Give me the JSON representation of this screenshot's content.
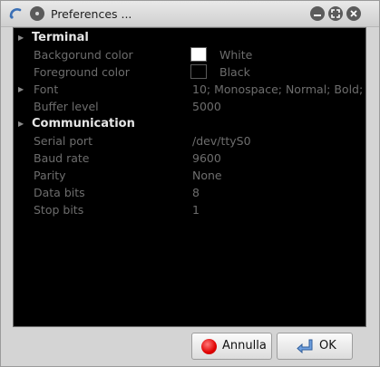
{
  "window": {
    "title": "Preferences ..."
  },
  "rows": [
    {
      "type": "group",
      "label": "Terminal"
    },
    {
      "type": "prop",
      "label": "Backgorund color",
      "value": "White",
      "swatch": "#ffffff"
    },
    {
      "type": "prop",
      "label": "Foreground color",
      "value": "Black",
      "swatch": "#000000"
    },
    {
      "type": "prop",
      "label": "Font",
      "value": "10; Monospace; Normal; Bold;",
      "arrow": true
    },
    {
      "type": "prop",
      "label": "Buffer level",
      "value": "5000"
    },
    {
      "type": "group",
      "label": "Communication"
    },
    {
      "type": "prop",
      "label": "Serial port",
      "value": "/dev/ttyS0"
    },
    {
      "type": "prop",
      "label": "Baud rate",
      "value": "9600"
    },
    {
      "type": "prop",
      "label": "Parity",
      "value": "None"
    },
    {
      "type": "prop",
      "label": "Data bits",
      "value": "8"
    },
    {
      "type": "prop",
      "label": "Stop bits",
      "value": "1"
    }
  ],
  "buttons": {
    "cancel_label": "Annulla",
    "ok_label": "OK"
  },
  "colors": {
    "panel_bg": "#000000",
    "group_text": "#e6e6e6",
    "prop_text": "#6d6d6d",
    "cancel_icon": "#e00000",
    "ok_icon": "#3b78c6"
  },
  "icons": {
    "app": "terminal-app-icon",
    "menu": "window-menu-icon",
    "minimize": "minimize-icon",
    "maximize": "maximize-icon",
    "close": "close-icon",
    "cancel": "cancel-icon",
    "ok": "enter-arrow-icon",
    "expander": "expander-arrow-icon"
  }
}
